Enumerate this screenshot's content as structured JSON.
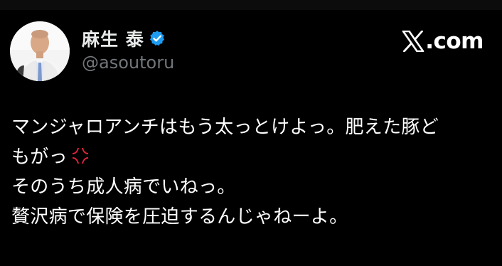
{
  "post": {
    "author": {
      "display_name": "麻生 泰",
      "handle": "@asoutoru",
      "verified": true,
      "avatar_icon": "profile-photo"
    },
    "site_logo": {
      "mark": "X",
      "text": ".com"
    },
    "lines": [
      {
        "text": "マンジャロアンチはもう太っとけよっ。肥えた豚ど"
      },
      {
        "text": "もがっ",
        "emoji": "anger-symbol"
      },
      {
        "text": "そのうち成人病でいねっ。"
      },
      {
        "text": "贅沢病で保険を圧迫するんじゃねーよ。"
      }
    ]
  },
  "colors": {
    "background": "#000000",
    "text_primary": "#ffffff",
    "text_secondary": "#71767b",
    "verified_blue": "#1d9bf0",
    "anger_red": "#e0243b"
  }
}
